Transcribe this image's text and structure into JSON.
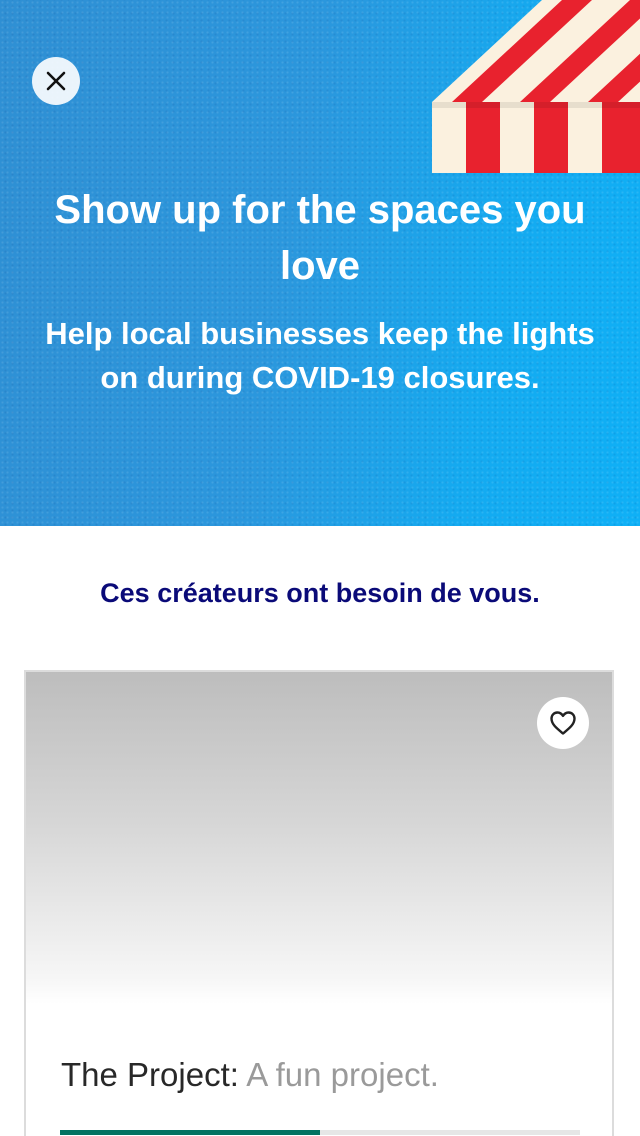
{
  "hero": {
    "title": "Show up for the spaces you love",
    "subtitle": "Help local businesses keep the lights on during COVID-19 closures.",
    "close_icon": "close-icon",
    "background_color": "#2b97dd"
  },
  "section": {
    "heading": "Ces créateurs ont besoin de vous."
  },
  "project_card": {
    "name": "The Project:",
    "blurb": "A fun project.",
    "favorite_icon": "heart-outline-icon",
    "funding_progress": 0.5,
    "progress_color": "#037362"
  },
  "colors": {
    "heading": "#0a0a78",
    "awning_red": "#e8222e",
    "awning_cream": "#fbf1df"
  }
}
